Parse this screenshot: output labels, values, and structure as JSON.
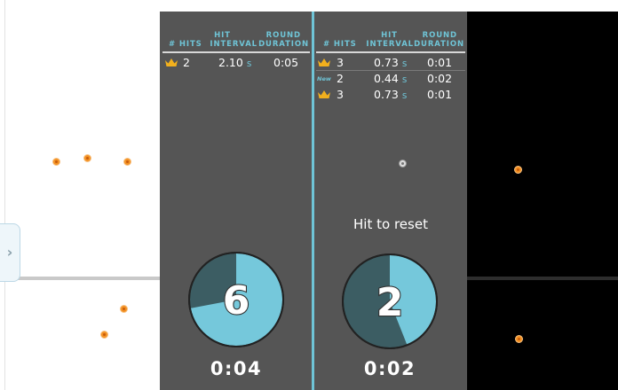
{
  "left_panel": {
    "expand_glyph": "›"
  },
  "table_headers": {
    "hits": "# HITS",
    "interval_l1": "HIT",
    "interval_l2": "INTERVAL",
    "duration_l1": "ROUND",
    "duration_l2": "DURATION"
  },
  "panel_a": {
    "rows": [
      {
        "badge": "crown-icon",
        "hits": "2",
        "interval": "2.10",
        "unit": "s",
        "duration": "0:05"
      }
    ],
    "pie_number": "6",
    "pie_fraction": 0.72,
    "timer": "0:04"
  },
  "panel_b": {
    "rows": [
      {
        "badge": "crown-icon",
        "hits": "3",
        "interval": "0.73",
        "unit": "s",
        "duration": "0:01"
      },
      {
        "badge": "New",
        "hits": "2",
        "interval": "0.44",
        "unit": "s",
        "duration": "0:02"
      },
      {
        "badge": "crown-icon",
        "hits": "3",
        "interval": "0.73",
        "unit": "s",
        "duration": "0:01"
      }
    ],
    "reset_text": "Hit to reset",
    "pie_number": "2",
    "pie_fraction": 0.44,
    "timer": "0:02"
  },
  "colors": {
    "accent_cyan": "#6fc4d6",
    "pie_dark": "#3c5d63",
    "panel_grey": "#555555",
    "target_orange": "#f39224",
    "crown_gold": "#f2b01d"
  }
}
